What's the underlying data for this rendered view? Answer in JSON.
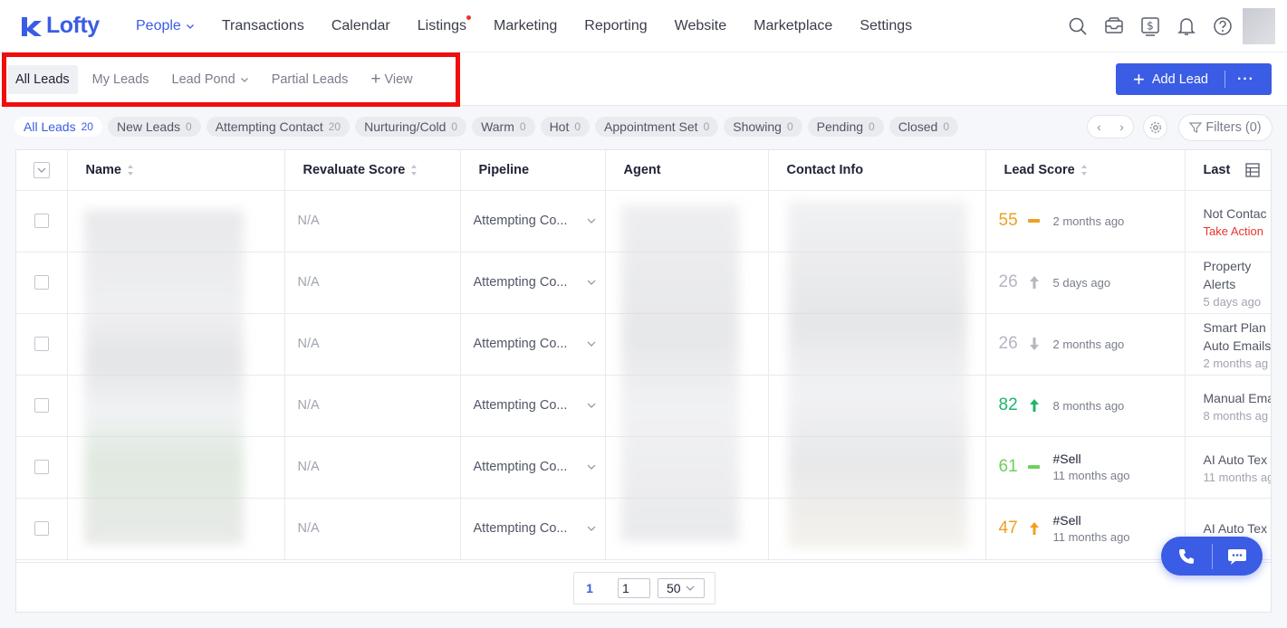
{
  "brand": {
    "name": "Lofty",
    "color": "#3b5ce5"
  },
  "nav": {
    "items": [
      {
        "label": "People",
        "active": true,
        "has_caret": true
      },
      {
        "label": "Transactions"
      },
      {
        "label": "Calendar"
      },
      {
        "label": "Listings",
        "has_dot": true
      },
      {
        "label": "Marketing"
      },
      {
        "label": "Reporting"
      },
      {
        "label": "Website"
      },
      {
        "label": "Marketplace"
      },
      {
        "label": "Settings"
      }
    ],
    "right_icons": [
      "search-icon",
      "inbox-icon",
      "dollar-icon",
      "bell-icon",
      "help-icon"
    ]
  },
  "views": {
    "tabs": [
      {
        "label": "All Leads",
        "active": true
      },
      {
        "label": "My Leads"
      },
      {
        "label": "Lead Pond",
        "has_caret": true
      },
      {
        "label": "Partial Leads"
      }
    ],
    "add_view_label": "View"
  },
  "add_lead": {
    "label": "Add Lead"
  },
  "stages": [
    {
      "label": "All Leads",
      "count": "20",
      "active": true
    },
    {
      "label": "New Leads",
      "count": "0"
    },
    {
      "label": "Attempting Contact",
      "count": "20"
    },
    {
      "label": "Nurturing/Cold",
      "count": "0"
    },
    {
      "label": "Warm",
      "count": "0"
    },
    {
      "label": "Hot",
      "count": "0"
    },
    {
      "label": "Appointment Set",
      "count": "0"
    },
    {
      "label": "Showing",
      "count": "0"
    },
    {
      "label": "Pending",
      "count": "0"
    },
    {
      "label": "Closed",
      "count": "0"
    }
  ],
  "filters": {
    "label": "Filters (0)"
  },
  "table": {
    "columns": [
      "Name",
      "Revaluate Score",
      "Pipeline",
      "Agent",
      "Contact Info",
      "Lead Score",
      "Last"
    ],
    "rows": [
      {
        "revaluate": "N/A",
        "pipeline": "Attempting Co...",
        "score": "55",
        "trend": "flat",
        "score_color": "#f0a020",
        "tag": "",
        "score_time": "2 months ago",
        "last": "Not Contac",
        "last_sub": "",
        "last_action": "Take Action"
      },
      {
        "revaluate": "N/A",
        "pipeline": "Attempting Co...",
        "score": "26",
        "trend": "up",
        "score_color": "#b4b7c0",
        "tag": "",
        "score_time": "5 days ago",
        "last": "Property Alerts",
        "last_sub": "5 days ago",
        "last_action": ""
      },
      {
        "revaluate": "N/A",
        "pipeline": "Attempting Co...",
        "score": "26",
        "trend": "down",
        "score_color": "#b4b7c0",
        "tag": "",
        "score_time": "2 months ago",
        "last": "Smart Plan Auto Emails",
        "last_sub": "2 months ag",
        "last_action": ""
      },
      {
        "revaluate": "N/A",
        "pipeline": "Attempting Co...",
        "score": "82",
        "trend": "up",
        "score_color": "#1fb46a",
        "tag": "",
        "score_time": "8 months ago",
        "last": "Manual Ema",
        "last_sub": "8 months ag",
        "last_action": ""
      },
      {
        "revaluate": "N/A",
        "pipeline": "Attempting Co...",
        "score": "61",
        "trend": "flat",
        "score_color": "#6fcf5a",
        "tag": "#Sell",
        "score_time": "11 months ago",
        "last": "AI Auto Tex",
        "last_sub": "11 months ag",
        "last_action": ""
      },
      {
        "revaluate": "N/A",
        "pipeline": "Attempting Co...",
        "score": "47",
        "trend": "up",
        "score_color": "#f0a020",
        "tag": "#Sell",
        "score_time": "11 months ago",
        "last": "AI Auto Tex",
        "last_sub": "",
        "last_action": ""
      }
    ]
  },
  "pagination": {
    "current": "1",
    "input_value": "1",
    "page_size": "50"
  }
}
